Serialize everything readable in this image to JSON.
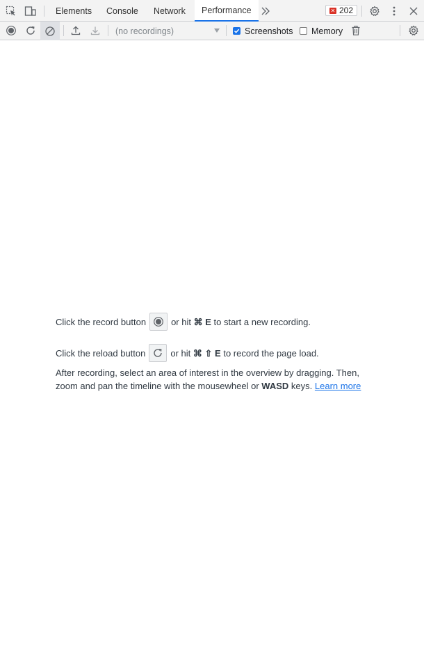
{
  "tabs": [
    {
      "label": "Elements"
    },
    {
      "label": "Console"
    },
    {
      "label": "Network"
    },
    {
      "label": "Performance",
      "active": true
    }
  ],
  "badge": {
    "count": "202"
  },
  "toolbar": {
    "recordings_placeholder": "(no recordings)",
    "screenshots_label": "Screenshots",
    "screenshots_checked": true,
    "memory_label": "Memory",
    "memory_checked": false
  },
  "landing": {
    "record_prefix": "Click the record button",
    "record_or_hit": "or hit",
    "record_shortcut_cmd": "⌘",
    "record_shortcut_key": "E",
    "record_suffix": "to start a new recording.",
    "reload_prefix": "Click the reload button",
    "reload_or_hit": "or hit",
    "reload_shortcut_cmd": "⌘",
    "reload_shortcut_shift": "⇧",
    "reload_shortcut_key": "E",
    "reload_suffix": "to record the page load.",
    "hint_part1": "After recording, select an area of interest in the overview by dragging. Then, zoom and pan the timeline with the mousewheel or",
    "hint_keys": "WASD",
    "hint_part2": "keys.",
    "learn_more": "Learn more"
  },
  "colors": {
    "accent": "#1a73e8",
    "error": "#d93025",
    "toolbar_bg": "#f3f3f3"
  }
}
